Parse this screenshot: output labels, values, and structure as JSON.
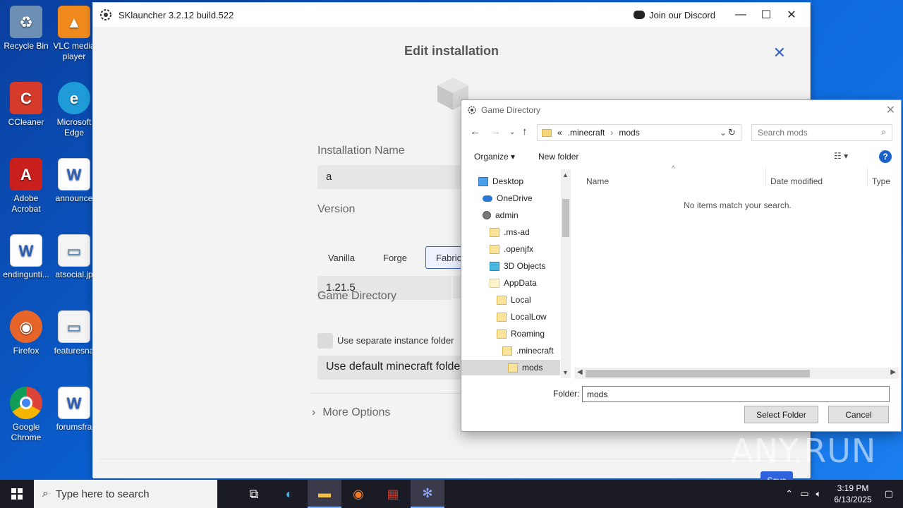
{
  "desktop": {
    "icons": [
      {
        "label": "Recycle Bin",
        "icon": "recycle-bin-icon"
      },
      {
        "label": "VLC media player",
        "icon": "vlc-icon"
      },
      {
        "label": "CCleaner",
        "icon": "ccleaner-icon"
      },
      {
        "label": "Microsoft Edge",
        "icon": "edge-icon"
      },
      {
        "label": "Adobe Acrobat",
        "icon": "acrobat-icon"
      },
      {
        "label": "announce",
        "icon": "word-doc-icon"
      },
      {
        "label": "endingunti...",
        "icon": "word-doc-icon"
      },
      {
        "label": "atsocial.jp",
        "icon": "image-file-icon"
      },
      {
        "label": "Firefox",
        "icon": "firefox-icon"
      },
      {
        "label": "featuresna",
        "icon": "image-file-icon"
      },
      {
        "label": "Google Chrome",
        "icon": "chrome-icon"
      },
      {
        "label": "forumsfra",
        "icon": "word-doc-icon"
      }
    ]
  },
  "launcher": {
    "title": "SKlauncher 3.2.12 build.522",
    "discord_label": "Join our Discord",
    "heading": "Edit installation",
    "installation_name_label": "Installation Name",
    "installation_name_value": "a",
    "version_label": "Version",
    "loaders": [
      "Vanilla",
      "Forge",
      "Fabric"
    ],
    "selected_loader": "Fabric",
    "version_value": "1.21.5",
    "game_directory_label": "Game Directory",
    "separate_folder_label": "Use separate instance folder",
    "default_folder_button": "Use default minecraft folder",
    "more_options_label": "More Options",
    "save_label": "Save"
  },
  "dialog": {
    "title": "Game Directory",
    "path": [
      "«",
      ".minecraft",
      "mods"
    ],
    "search_placeholder": "Search mods",
    "organize_label": "Organize",
    "new_folder_label": "New folder",
    "help_label": "?",
    "tree": [
      {
        "label": "Desktop",
        "icon": "blue"
      },
      {
        "label": "OneDrive",
        "icon": "cloud"
      },
      {
        "label": "admin",
        "icon": "user"
      },
      {
        "label": ".ms-ad",
        "icon": "folder"
      },
      {
        "label": ".openjfx",
        "icon": "folder"
      },
      {
        "label": "3D Objects",
        "icon": "cube3d"
      },
      {
        "label": "AppData",
        "icon": "pale"
      },
      {
        "label": "Local",
        "icon": "folder"
      },
      {
        "label": "LocalLow",
        "icon": "folder"
      },
      {
        "label": "Roaming",
        "icon": "folder"
      },
      {
        "label": ".minecraft",
        "icon": "folder"
      },
      {
        "label": "mods",
        "icon": "folder",
        "selected": true
      }
    ],
    "columns": [
      "Name",
      "Date modified",
      "Type"
    ],
    "empty_message": "No items match your search.",
    "folder_label": "Folder:",
    "folder_value": "mods",
    "select_folder_label": "Select Folder",
    "cancel_label": "Cancel"
  },
  "taskbar": {
    "search_placeholder": "Type here to search",
    "time": "3:19 PM",
    "date": "6/13/2025",
    "apps": [
      "task-view-icon",
      "edge-icon",
      "file-explorer-icon",
      "firefox-icon",
      "winrar-icon",
      "sklauncher-icon"
    ]
  },
  "watermark": "ANY.RUN"
}
